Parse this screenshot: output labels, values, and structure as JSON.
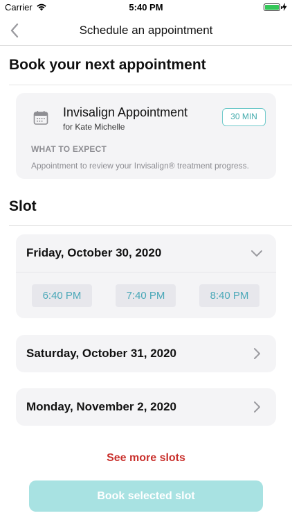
{
  "status_bar": {
    "carrier": "Carrier",
    "time": "5:40 PM",
    "battery_level": 1.0
  },
  "nav": {
    "title": "Schedule an appointment",
    "back_icon": "chevron-left-icon"
  },
  "sections": {
    "book_title": "Book your next appointment",
    "slot_title": "Slot"
  },
  "appointment": {
    "title": "Invisalign Appointment",
    "for": "for Kate Michelle",
    "duration": "30 MIN",
    "expect_label": "WHAT TO EXPECT",
    "expect_text": "Appointment to review your Invisalign® treatment progress.",
    "icon": "calendar-icon"
  },
  "days": [
    {
      "label": "Friday, October 30, 2020",
      "expanded": true,
      "times": [
        "6:40 PM",
        "7:40 PM",
        "8:40 PM"
      ]
    },
    {
      "label": "Saturday, October 31, 2020",
      "expanded": false
    },
    {
      "label": "Monday, November 2, 2020",
      "expanded": false
    }
  ],
  "actions": {
    "see_more": "See more slots",
    "book": "Book selected slot"
  },
  "colors": {
    "accent_teal": "#4aa8b8",
    "book_button_disabled": "#a8e2e2",
    "see_more_red": "#c9302c",
    "card_background": "#f4f4f6"
  }
}
